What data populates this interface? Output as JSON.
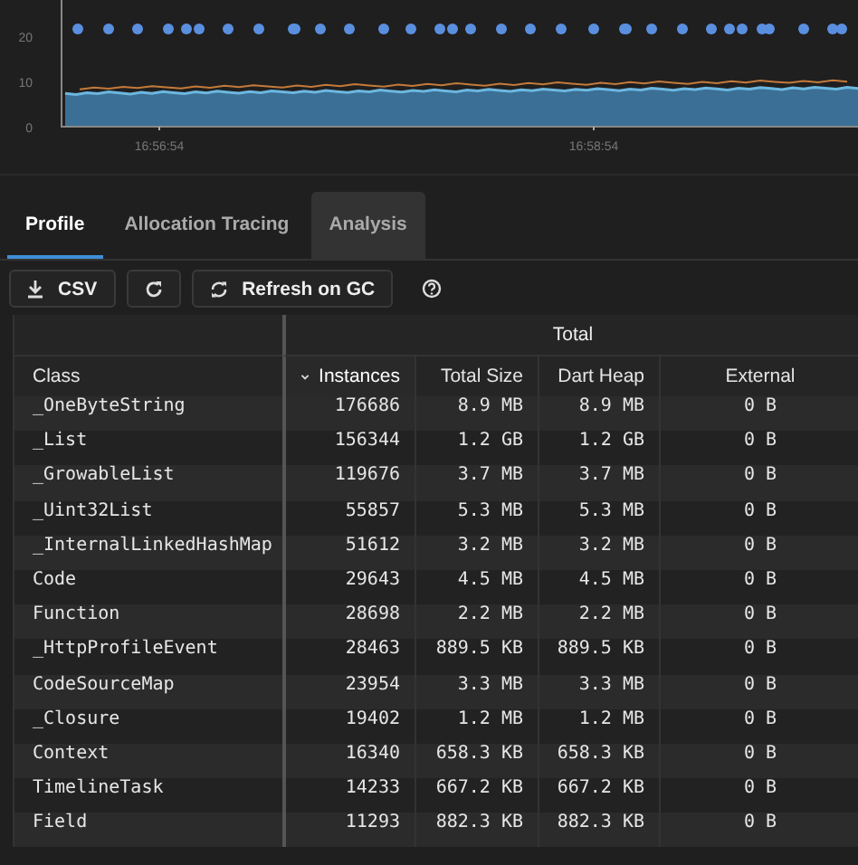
{
  "chart": {
    "y_ticks": [
      "20",
      "10",
      "0"
    ],
    "x_ticks": [
      "16:56:54",
      "16:58:54"
    ]
  },
  "tabs": [
    {
      "label": "Profile",
      "selected": true,
      "hovered": false
    },
    {
      "label": "Allocation Tracing",
      "selected": false,
      "hovered": false
    },
    {
      "label": "Analysis",
      "selected": false,
      "hovered": true
    }
  ],
  "toolbar": [
    {
      "kind": "download",
      "label": "CSV"
    },
    {
      "kind": "refresh"
    },
    {
      "kind": "refresh-gc",
      "label": "Refresh on GC"
    },
    {
      "kind": "help"
    }
  ],
  "table": {
    "group_header": "Total",
    "columns": [
      {
        "label": "Class",
        "sorted": false
      },
      {
        "label": "Instances",
        "sorted": true
      },
      {
        "label": "Total Size",
        "sorted": false
      },
      {
        "label": "Dart Heap",
        "sorted": false
      },
      {
        "label": "External",
        "sorted": false
      }
    ],
    "rows": [
      [
        "_OneByteString",
        "176686",
        "8.9 MB",
        "8.9 MB",
        "0 B"
      ],
      [
        "_List",
        "156344",
        "1.2 GB",
        "1.2 GB",
        "0 B"
      ],
      [
        "_GrowableList",
        "119676",
        "3.7 MB",
        "3.7 MB",
        "0 B"
      ],
      [
        "_Uint32List",
        "55857",
        "5.3 MB",
        "5.3 MB",
        "0 B"
      ],
      [
        "_InternalLinkedHashMap",
        "51612",
        "3.2 MB",
        "3.2 MB",
        "0 B"
      ],
      [
        "Code",
        "29643",
        "4.5 MB",
        "4.5 MB",
        "0 B"
      ],
      [
        "Function",
        "28698",
        "2.2 MB",
        "2.2 MB",
        "0 B"
      ],
      [
        "_HttpProfileEvent",
        "28463",
        "889.5 KB",
        "889.5 KB",
        "0 B"
      ],
      [
        "CodeSourceMap",
        "23954",
        "3.3 MB",
        "3.3 MB",
        "0 B"
      ],
      [
        "_Closure",
        "19402",
        "1.2 MB",
        "1.2 MB",
        "0 B"
      ],
      [
        "Context",
        "16340",
        "658.3 KB",
        "658.3 KB",
        "0 B"
      ],
      [
        "TimelineTask",
        "14233",
        "667.2 KB",
        "667.2 KB",
        "0 B"
      ],
      [
        "Field",
        "11293",
        "882.3 KB",
        "882.3 KB",
        "0 B"
      ]
    ]
  }
}
